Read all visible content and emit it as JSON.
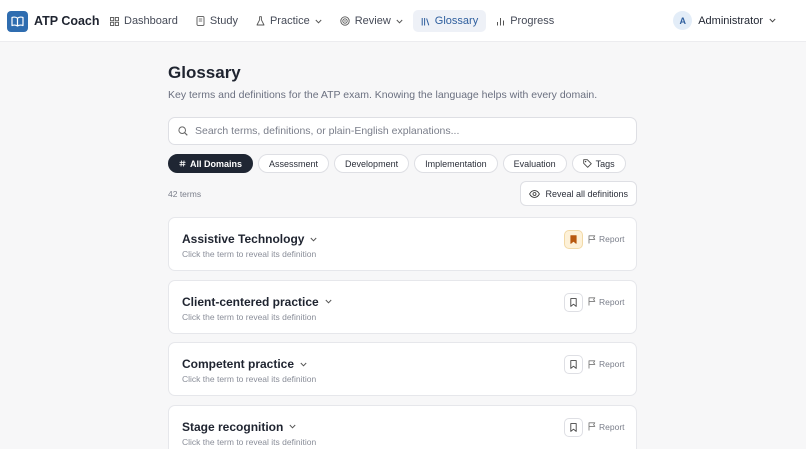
{
  "app": {
    "name": "ATP Coach"
  },
  "nav": {
    "items": [
      {
        "label": "Dashboard",
        "icon": "dashboard-icon",
        "dropdown": false,
        "active": false
      },
      {
        "label": "Study",
        "icon": "book-icon",
        "dropdown": false,
        "active": false
      },
      {
        "label": "Practice",
        "icon": "flask-icon",
        "dropdown": true,
        "active": false
      },
      {
        "label": "Review",
        "icon": "target-icon",
        "dropdown": true,
        "active": false
      },
      {
        "label": "Glossary",
        "icon": "library-icon",
        "dropdown": false,
        "active": true
      },
      {
        "label": "Progress",
        "icon": "bar-chart-icon",
        "dropdown": false,
        "active": false
      }
    ]
  },
  "user": {
    "initial": "A",
    "name": "Administrator"
  },
  "page": {
    "title": "Glossary",
    "subtitle": "Key terms and definitions for the ATP exam. Knowing the language helps with every domain."
  },
  "search": {
    "placeholder": "Search terms, definitions, or plain-English explanations...",
    "value": ""
  },
  "filters": [
    {
      "label": "All Domains",
      "active": true,
      "icon": "hash-icon"
    },
    {
      "label": "Assessment",
      "active": false
    },
    {
      "label": "Development",
      "active": false
    },
    {
      "label": "Implementation",
      "active": false
    },
    {
      "label": "Evaluation",
      "active": false
    },
    {
      "label": "Tags",
      "active": false,
      "icon": "tag-icon"
    }
  ],
  "term_count": "42 terms",
  "reveal_label": "Reveal all definitions",
  "terms": [
    {
      "name": "Assistive Technology",
      "hint": "Click the term to reveal its definition",
      "bookmarked": true,
      "report_label": "Report"
    },
    {
      "name": "Client-centered practice",
      "hint": "Click the term to reveal its definition",
      "bookmarked": false,
      "report_label": "Report"
    },
    {
      "name": "Competent practice",
      "hint": "Click the term to reveal its definition",
      "bookmarked": false,
      "report_label": "Report"
    },
    {
      "name": "Stage recognition",
      "hint": "Click the term to reveal its definition",
      "bookmarked": false,
      "report_label": "Report"
    }
  ],
  "colors": {
    "brand": "#2f6db0",
    "active_nav_bg": "#eef1f7",
    "active_chip_bg": "#1f2633",
    "bookmark_on_bg": "#fdf1d8",
    "bookmark_on_icon": "#b8590f"
  }
}
